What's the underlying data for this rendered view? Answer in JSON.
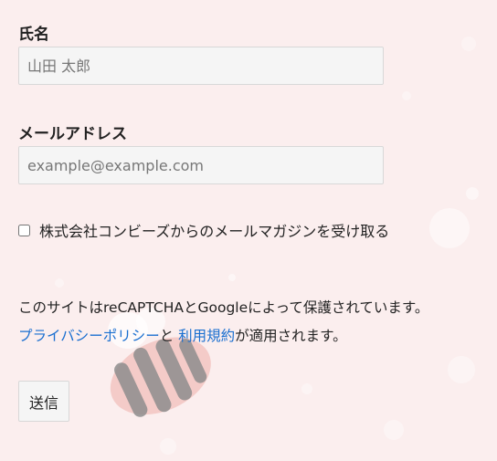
{
  "form": {
    "name_label": "氏名",
    "name_placeholder": "山田 太郎",
    "email_label": "メールアドレス",
    "email_placeholder": "example@example.com",
    "newsletter_label": "株式会社コンビーズからのメールマガジンを受け取る",
    "newsletter_checked": false,
    "notice_text": "このサイトはreCAPTCHAとGoogleによって保護されています。",
    "privacy_link": "プライバシーポリシー",
    "notice_and": "と",
    "terms_link": "利用規約",
    "notice_tail": "が適用されます。",
    "submit_label": "送信"
  },
  "colors": {
    "background": "#fbeeee",
    "link": "#1a6fd0",
    "input_bg": "#f5f5f5",
    "input_border": "#d8d8d8"
  }
}
